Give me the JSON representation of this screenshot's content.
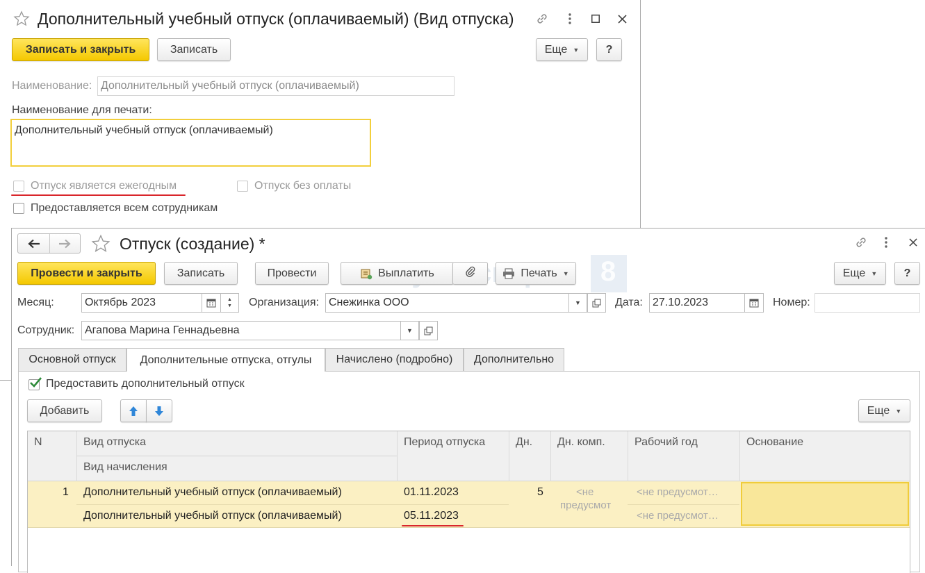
{
  "window1": {
    "title": "Дополнительный учебный отпуск (оплачиваемый) (Вид отпуска)",
    "buttons": {
      "save_close": "Записать и закрыть",
      "save": "Записать",
      "more": "Еще",
      "help": "?"
    },
    "name_label": "Наименование:",
    "name_value": "Дополнительный учебный отпуск (оплачиваемый)",
    "print_name_label": "Наименование для печати:",
    "print_name_value": "Дополнительный учебный отпуск (оплачиваемый)",
    "checkboxes": {
      "annual": {
        "label": "Отпуск является ежегодным",
        "checked": false
      },
      "unpaid": {
        "label": "Отпуск без оплаты",
        "checked": false
      },
      "all_employees": {
        "label": "Предоставляется всем сотрудникам",
        "checked": false
      }
    }
  },
  "window2": {
    "title": "Отпуск (создание) *",
    "buttons": {
      "post_close": "Провести и закрыть",
      "save": "Записать",
      "post": "Провести",
      "pay": "Выплатить",
      "print": "Печать",
      "more": "Еще",
      "help": "?"
    },
    "month_label": "Месяц:",
    "month_value": "Октябрь 2023",
    "org_label": "Организация:",
    "org_value": "Снежинка ООО",
    "date_label": "Дата:",
    "date_value": "27.10.2023",
    "number_label": "Номер:",
    "number_value": "",
    "employee_label": "Сотрудник:",
    "employee_value": "Агапова Марина Геннадьевна",
    "tabs": [
      "Основной отпуск",
      "Дополнительные отпуска, отгулы",
      "Начислено (подробно)",
      "Дополнительно"
    ],
    "provide_label": "Предоставить дополнительный отпуск",
    "provide_checked": true,
    "add_label": "Добавить",
    "table_more": "Еще",
    "columns": {
      "n": "N",
      "type": "Вид отпуска",
      "accrual": "Вид начисления",
      "period": "Период отпуска",
      "days": "Дн.",
      "comp_days": "Дн. комп.",
      "work_year": "Рабочий год",
      "basis": "Основание"
    },
    "rows": [
      {
        "n": "1",
        "type": "Дополнительный учебный отпуск (оплачиваемый)",
        "accrual": "Дополнительный учебный отпуск (оплачиваемый)",
        "start": "01.11.2023",
        "end": "05.11.2023",
        "days": "5",
        "comp_line1": "<не",
        "comp_line2": "предусмот",
        "work_year_1": "<не предусмот…",
        "work_year_2": "<не предусмот…",
        "basis": ""
      }
    ]
  },
  "watermark": {
    "brand": "БухЭксперт",
    "number": "8",
    "tagline": "а ответов по учёту"
  },
  "colors": {
    "accent_yellow": "#f4c800",
    "selected_row": "#fbf0c3",
    "highlight_red": "#d9262b",
    "checkmark_green": "#2e8b3a"
  }
}
